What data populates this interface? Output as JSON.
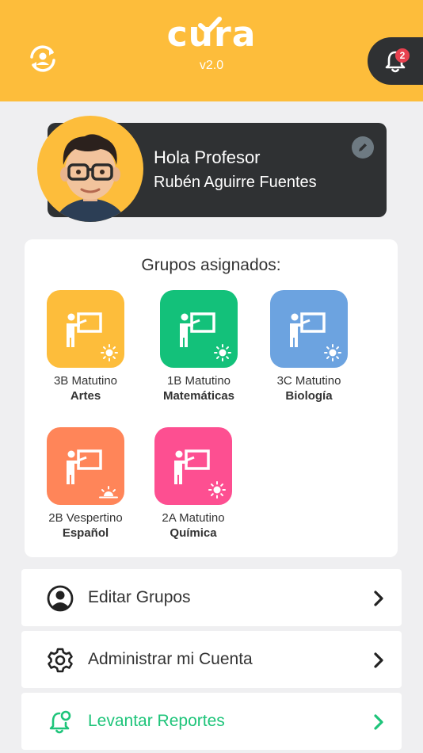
{
  "app": {
    "logo_text": "cura",
    "version": "v2.0",
    "brand_color": "#fdbd3b",
    "dark_color": "#2f3133"
  },
  "header": {
    "sync_icon": "user-sync-icon",
    "notifications": {
      "icon": "bell-icon",
      "badge_count": "2",
      "badge_color": "#e8414f"
    }
  },
  "profile": {
    "greeting": "Hola Profesor",
    "name": "Rubén Aguirre Fuentes",
    "avatar": "memoji-avatar",
    "edit_icon": "pencil-icon"
  },
  "groups": {
    "title": "Grupos asignados:",
    "items": [
      {
        "shift": "3B Matutino",
        "subject": "Artes",
        "color": "#fdbd3b",
        "shift_icon": "sun-icon"
      },
      {
        "shift": "1B Matutino",
        "subject": "Matemáticas",
        "color": "#13c17a",
        "shift_icon": "sun-icon"
      },
      {
        "shift": "3C Matutino",
        "subject": "Biología",
        "color": "#6ca3e0",
        "shift_icon": "sun-icon"
      },
      {
        "shift": "2B Vespertino",
        "subject": "Español",
        "color": "#ff8559",
        "shift_icon": "sunset-icon"
      },
      {
        "shift": "2A Matutino",
        "subject": "Química",
        "color": "#fd4f91",
        "shift_icon": "sun-icon"
      }
    ]
  },
  "menu": [
    {
      "label": "Editar Grupos",
      "icon": "user-circle-icon"
    },
    {
      "label": "Administrar mi Cuenta",
      "icon": "gear-icon"
    },
    {
      "label": "Levantar Reportes",
      "icon": "bell-alert-icon",
      "color": "#1ec47a"
    }
  ]
}
